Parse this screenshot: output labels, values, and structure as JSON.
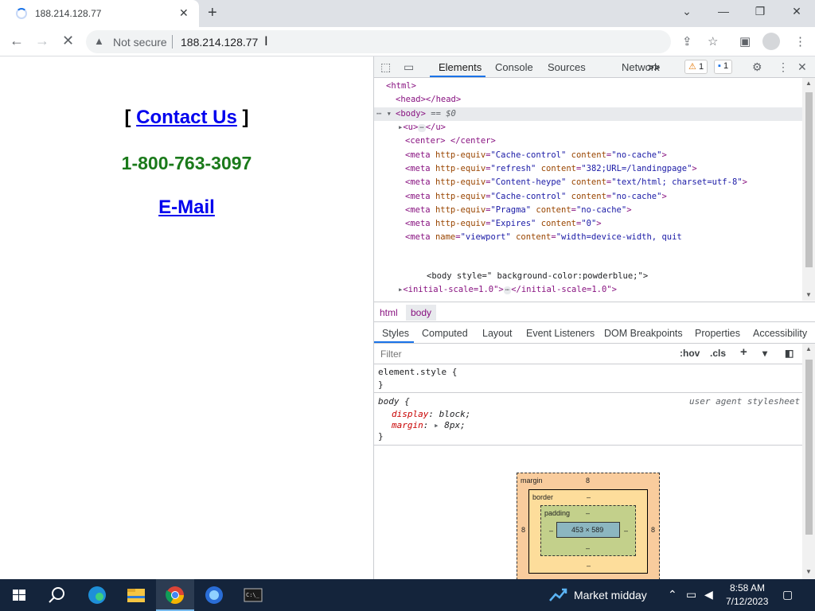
{
  "browser": {
    "tab_title": "188.214.128.77",
    "close_tab": "✕",
    "new_tab": "+",
    "win_minimize": "—",
    "win_restore": "❐",
    "win_close": "✕",
    "win_chevron": "⌄",
    "back": "←",
    "forward": "→",
    "reload": "✕",
    "security_label": "Not secure",
    "url": "188.214.128.77",
    "share_icon": "⇪",
    "star_icon": "☆",
    "sidepanel_icon": "▣",
    "menu_icon": "⋮"
  },
  "page": {
    "bracket_open": "[ ",
    "contact_link": "Contact Us",
    "bracket_close": " ]",
    "phone": "1-800-763-3097",
    "email_link": "E-Mail"
  },
  "devtools": {
    "tabs": [
      "Elements",
      "Console",
      "Sources",
      "Network"
    ],
    "more_tabs": ">>",
    "warnings_count": "1",
    "messages_count": "1",
    "dom_lines": {
      "html": "<html>",
      "head": "<head></head>",
      "body_open": "<body>",
      "body_eq": "== $0",
      "u_open": "<u>",
      "u_close": "</u>",
      "center": "<center> </center>",
      "meta1_an1": "http-equiv",
      "meta1_av1": "\"Cache-control\"",
      "meta1_an2": "content",
      "meta1_av2": "\"no-cache\"",
      "meta2_av1": "\"refresh\"",
      "meta2_av2": "\"382;URL=/landingpage\"",
      "meta3_av1": "\"Content-heype\"",
      "meta3_av2": "\"text/html; charset=utf-8\"",
      "meta4_av1": "\"Cache-control\"",
      "meta4_av2": "\"no-cache\"",
      "meta5_av1": "\"Pragma\"",
      "meta5_av2": "\"no-cache\"",
      "meta6_av1": "\"Expires\"",
      "meta6_av2": "\"0\"",
      "meta7_an1": "name",
      "meta7_av1": "\"viewport\"",
      "meta7_av2": "\"width=device-width, quit",
      "body_style_text": "<body style=\" background-color:powderblue;\">",
      "initial_open": "<initial-scale=1.0\">",
      "initial_close": "</initial-scale=1.0\">"
    },
    "breadcrumbs": [
      "html",
      "body"
    ],
    "style_tabs": [
      "Styles",
      "Computed",
      "Layout",
      "Event Listeners",
      "DOM Breakpoints",
      "Properties",
      "Accessibility"
    ],
    "filter_placeholder": "Filter",
    "hov": ":hov",
    "cls": ".cls",
    "element_style": "element.style {",
    "close_brace": "}",
    "body_selector": "body {",
    "ua_label": "user agent stylesheet",
    "prop_display": "display",
    "val_display": "block;",
    "prop_margin": "margin",
    "val_margin": "8px;",
    "box_model": {
      "margin_label": "margin",
      "margin_value": "8",
      "border_label": "border",
      "padding_label": "padding",
      "dash": "–",
      "content_size": "453 × 589"
    }
  },
  "taskbar": {
    "market_text": "Market midday",
    "time": "8:58 AM",
    "date": "7/12/2023"
  },
  "colors": {
    "link": "#0000ee",
    "phone_green": "#1b7a1b",
    "accent": "#1a73e8",
    "taskbar": "#14243b"
  }
}
